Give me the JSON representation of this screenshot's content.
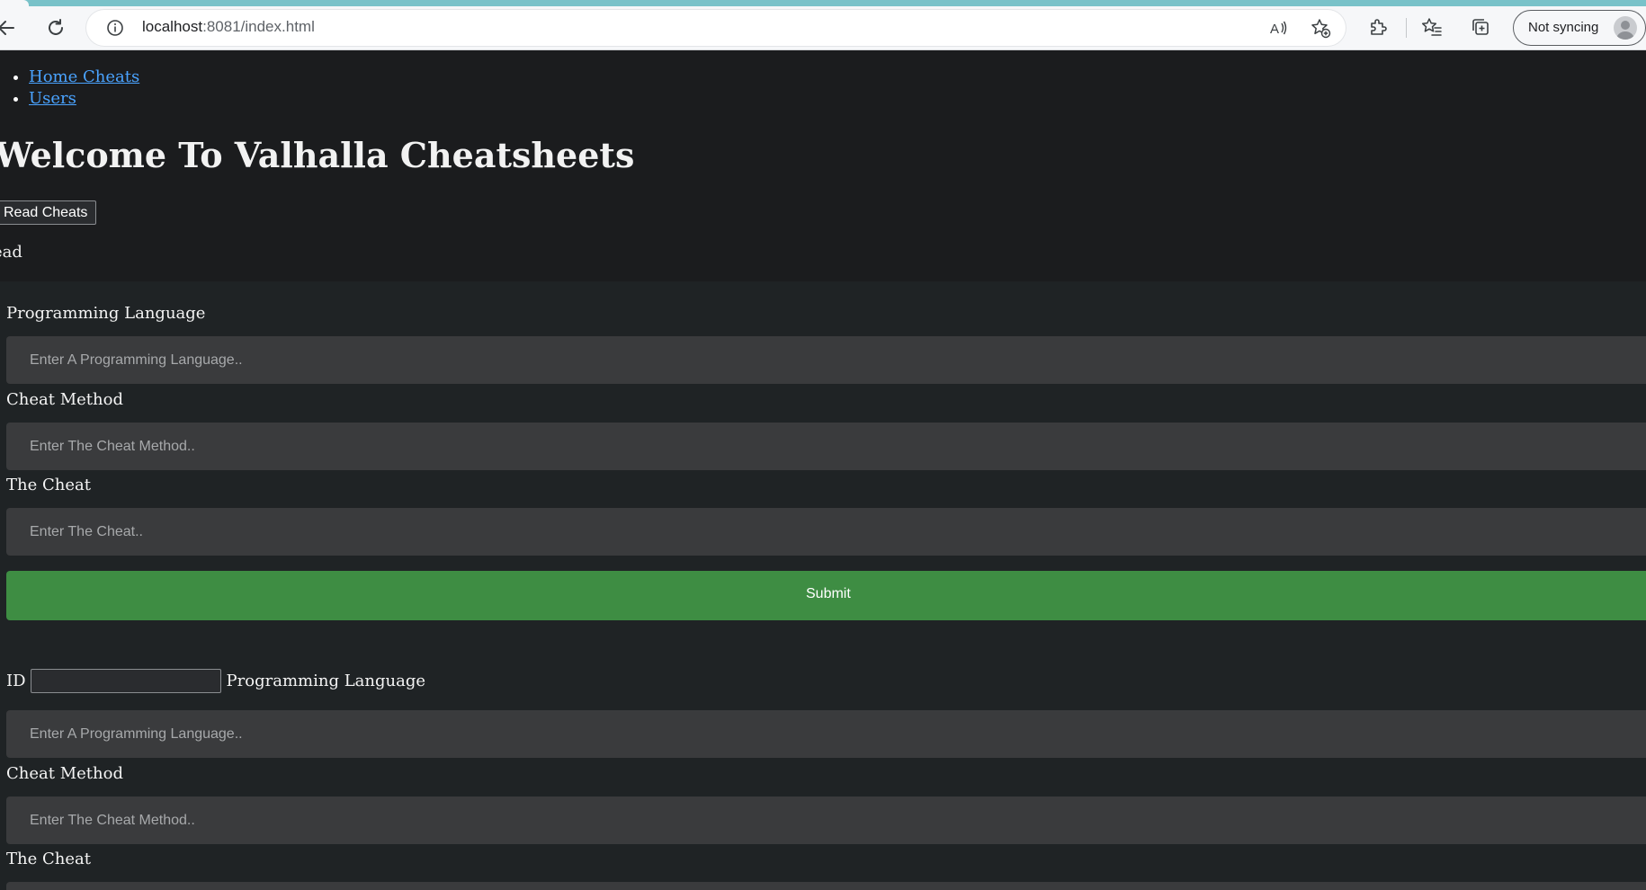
{
  "browser": {
    "url_host": "localhost",
    "url_rest": ":8081/index.html",
    "profile_label": "Not syncing"
  },
  "nav": {
    "items": [
      {
        "label": "Home Cheats"
      },
      {
        "label": "Users"
      }
    ]
  },
  "page": {
    "title": "Welcome To Valhalla Cheatsheets",
    "read_button": "Read Cheats",
    "read_output": "ead"
  },
  "create_form": {
    "language_label": "Programming Language",
    "language_placeholder": "Enter A Programming Language..",
    "method_label": "Cheat Method",
    "method_placeholder": "Enter The Cheat Method..",
    "cheat_label": "The Cheat",
    "cheat_placeholder": "Enter The Cheat..",
    "submit_label": "Submit"
  },
  "update_form": {
    "id_label": "ID",
    "language_label": "Programming Language",
    "language_placeholder": "Enter A Programming Language..",
    "method_label": "Cheat Method",
    "method_placeholder": "Enter The Cheat Method..",
    "cheat_label": "The Cheat"
  },
  "colors": {
    "page_bg": "#1b1c1e",
    "panel_bg": "#1f2325",
    "input_bg": "#3a3b3d",
    "submit_bg": "#3e8d43",
    "link": "#4aa3ff"
  }
}
